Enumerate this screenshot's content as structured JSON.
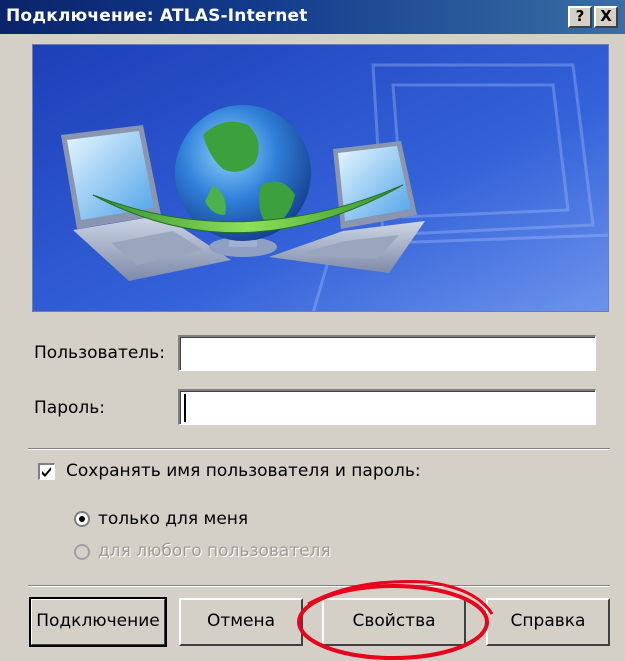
{
  "window": {
    "title": "Подключение: ATLAS-Internet",
    "help_btn": "?",
    "close_btn": "X"
  },
  "form": {
    "user_label": "Пользователь:",
    "user_value": "",
    "password_label": "Пароль:",
    "password_value": "",
    "save_checkbox_label": "Сохранять имя пользователя и пароль:",
    "save_checked": true,
    "radio_only_me": "только для меня",
    "radio_only_me_selected": true,
    "radio_anyone": "для любого пользователя",
    "radio_anyone_disabled": true
  },
  "buttons": {
    "connect": "Подключение",
    "cancel": "Отмена",
    "properties": "Свойства",
    "help": "Справка"
  },
  "annotation": {
    "color": "#e8001c",
    "highlights": "properties-button"
  },
  "colors": {
    "titlebar": "#0a246a",
    "face": "#d4d0c8",
    "banner_bg": "#2a52c8",
    "globe_ocean": "#2f7fd8",
    "globe_land": "#3ca03c",
    "swoosh": "#4caf30"
  },
  "icons": {
    "banner": "network-connection-illustration",
    "check": "check-icon",
    "radio": "radio-dot-icon"
  }
}
